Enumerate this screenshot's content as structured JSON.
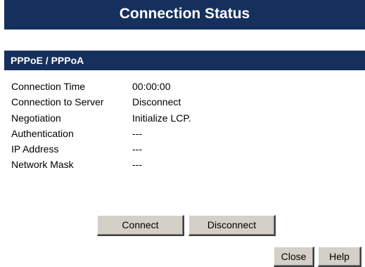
{
  "page": {
    "title": "Connection Status",
    "section_title": "PPPoE / PPPoA"
  },
  "status": [
    {
      "label": "Connection Time",
      "value": "00:00:00"
    },
    {
      "label": "Connection to Server",
      "value": "Disconnect"
    },
    {
      "label": "Negotiation",
      "value": "Initialize LCP."
    },
    {
      "label": "Authentication",
      "value": "---"
    },
    {
      "label": "IP Address",
      "value": "---"
    },
    {
      "label": "Network Mask",
      "value": "---"
    }
  ],
  "actions": {
    "connect_label": "Connect",
    "disconnect_label": "Disconnect"
  },
  "footer": {
    "close_label": "Close",
    "help_label": "Help"
  },
  "colors": {
    "header_background": "#16305e",
    "header_text": "#ffffff",
    "button_face": "#d4d0c8"
  }
}
